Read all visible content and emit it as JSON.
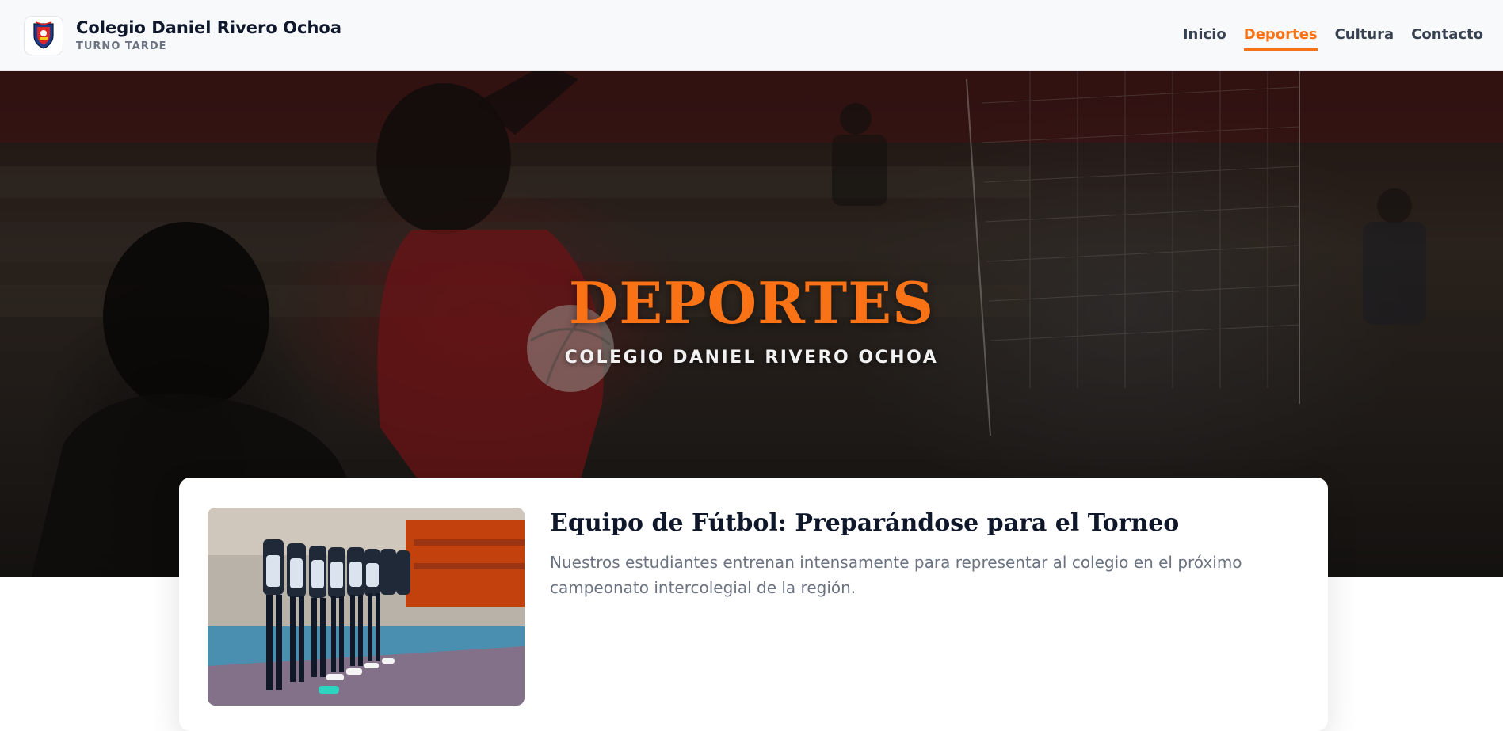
{
  "header": {
    "school_name": "Colegio Daniel Rivero Ochoa",
    "shift": "TURNO TARDE",
    "logo_icon": "school-crest-icon"
  },
  "nav": {
    "items": [
      {
        "label": "Inicio",
        "active": false
      },
      {
        "label": "Deportes",
        "active": true
      },
      {
        "label": "Cultura",
        "active": false
      },
      {
        "label": "Contacto",
        "active": false
      }
    ]
  },
  "hero": {
    "title": "DEPORTES",
    "subtitle": "COLEGIO DANIEL RIVERO OCHOA"
  },
  "article": {
    "title": "Equipo de Fútbol: Preparándose para el Torneo",
    "text": "Nuestros estudiantes entrenan intensamente para representar al colegio en el próximo campeonato intercolegial de la región."
  },
  "colors": {
    "accent": "#f97316",
    "text_dark": "#0f172a",
    "text_muted": "#6b7280",
    "header_bg": "#f8f9fb"
  }
}
